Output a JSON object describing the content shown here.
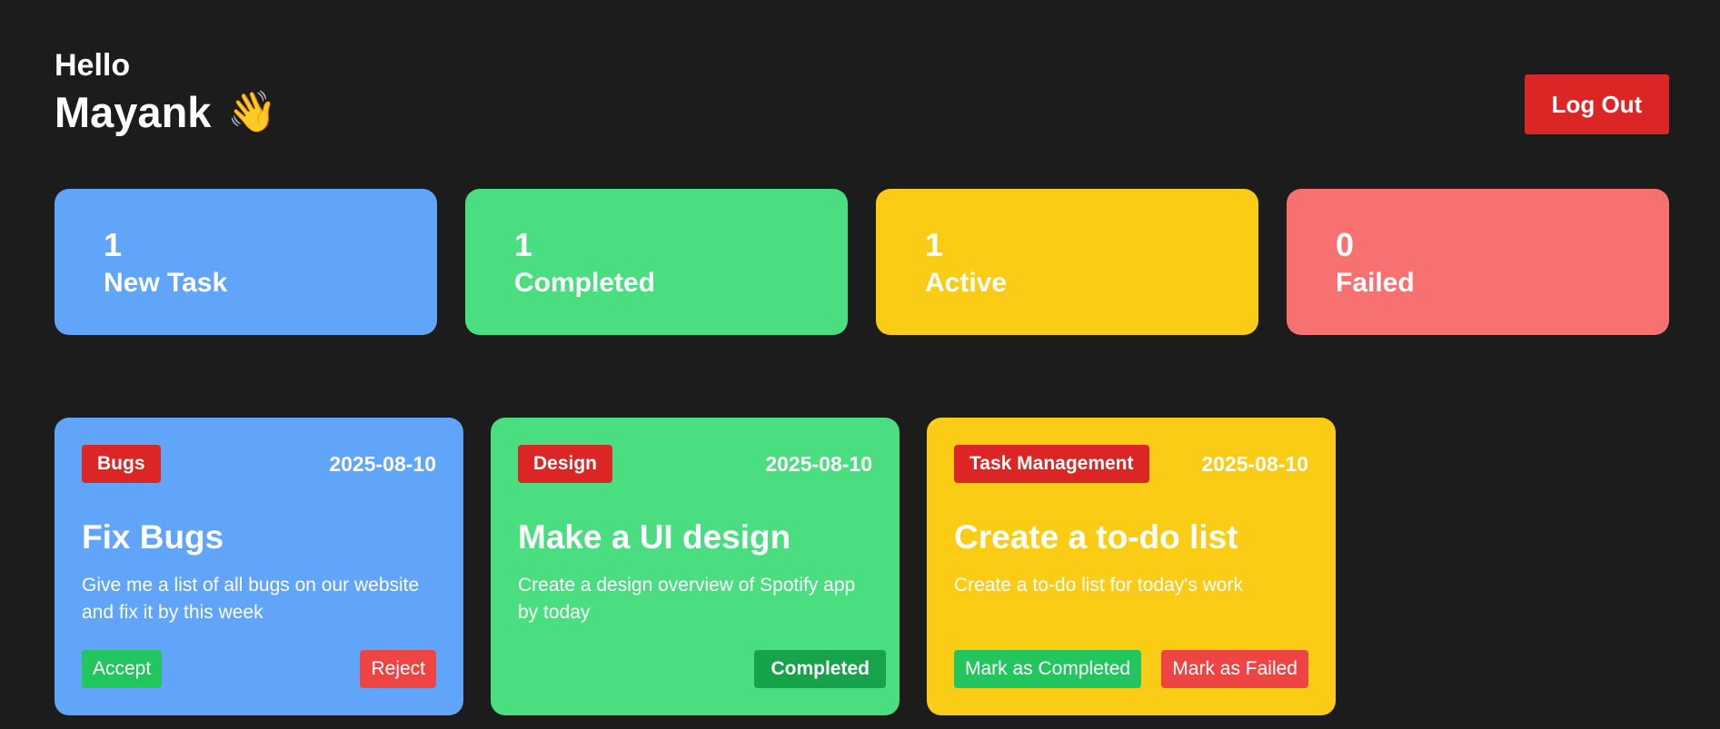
{
  "header": {
    "greeting": "Hello",
    "name": "Mayank",
    "wave_emoji": "👋",
    "logout_label": "Log Out"
  },
  "stats": [
    {
      "count": "1",
      "label": "New Task",
      "color": "#60a5fa"
    },
    {
      "count": "1",
      "label": "Completed",
      "color": "#4ade80"
    },
    {
      "count": "1",
      "label": "Active",
      "color": "#facc15"
    },
    {
      "count": "0",
      "label": "Failed",
      "color": "#f87171"
    }
  ],
  "tasks": [
    {
      "category": "Bugs",
      "date": "2025-08-10",
      "title": "Fix Bugs",
      "description": "Give me a list of all bugs on our website and fix it by this week",
      "color": "#60a5fa",
      "accept_label": "Accept",
      "reject_label": "Reject"
    },
    {
      "category": "Design",
      "date": "2025-08-10",
      "title": "Make a UI design",
      "description": "Create a design overview of Spotify app by today",
      "color": "#4ade80",
      "status_label": "Completed"
    },
    {
      "category": "Task Management",
      "date": "2025-08-10",
      "title": "Create a to-do list",
      "description": "Create a to-do list for today's work",
      "color": "#facc15",
      "complete_label": "Mark as Completed",
      "fail_label": "Mark as Failed"
    }
  ]
}
